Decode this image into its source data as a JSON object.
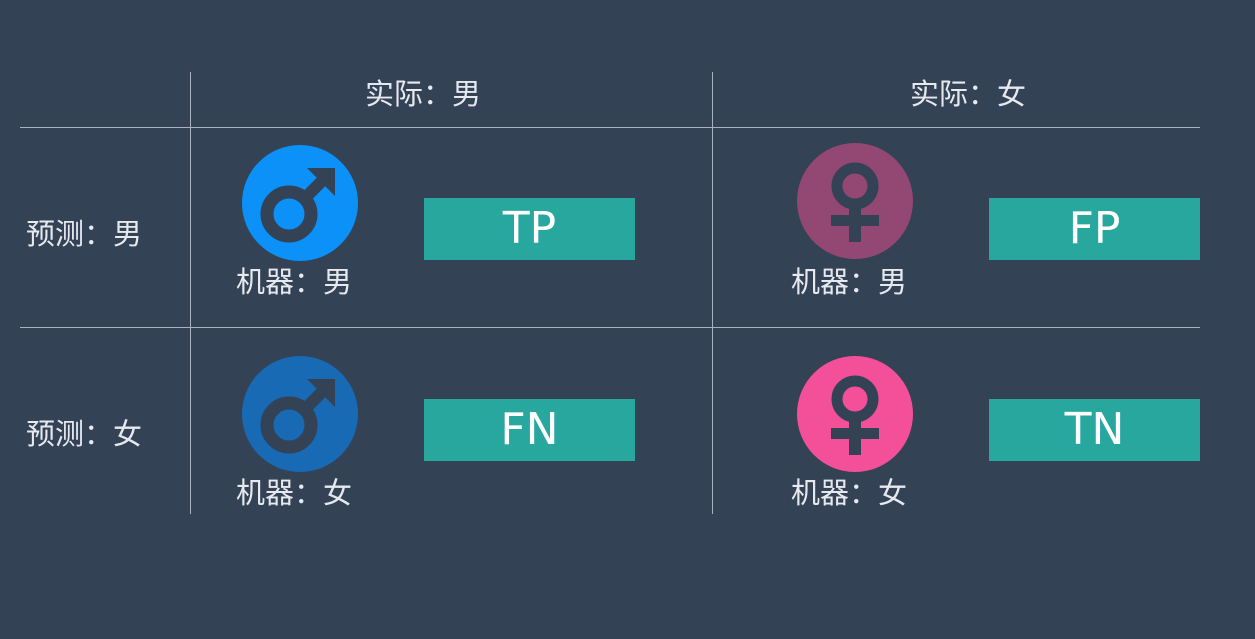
{
  "colors": {
    "background": "#344256",
    "grid_line": "#aab2bf",
    "badge": "#28a79f",
    "male_bright": "#0c91f9",
    "male_dark": "#176ab3",
    "female_muted": "#934773",
    "female_bright": "#f4509a",
    "symbol": "#344256"
  },
  "columns": [
    "实际：男",
    "实际：女"
  ],
  "rows": [
    "预测：男",
    "预测：女"
  ],
  "cells": [
    {
      "icon": "male-symbol-icon",
      "color": "#0c91f9",
      "label": "机器：男",
      "badge": "TP"
    },
    {
      "icon": "female-symbol-icon",
      "color": "#934773",
      "label": "机器：男",
      "badge": "FP"
    },
    {
      "icon": "male-symbol-icon",
      "color": "#176ab3",
      "label": "机器：女",
      "badge": "FN"
    },
    {
      "icon": "female-symbol-icon",
      "color": "#f4509a",
      "label": "机器：女",
      "badge": "TN"
    }
  ]
}
